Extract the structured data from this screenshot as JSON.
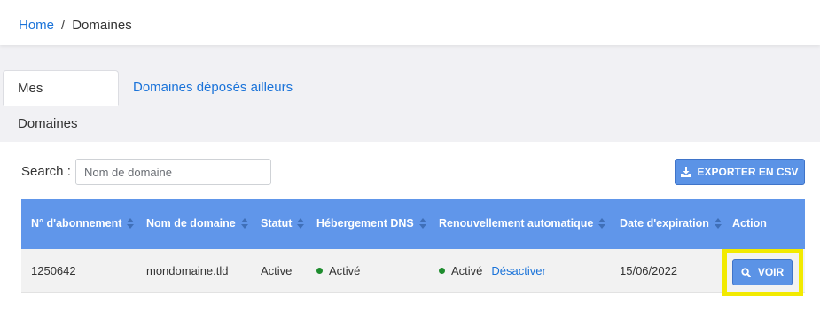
{
  "breadcrumb": {
    "home": "Home",
    "separator": "/",
    "current": "Domaines"
  },
  "tabs": [
    {
      "label": "Mes Domaines",
      "active": true
    },
    {
      "label": "Domaines déposés ailleurs",
      "active": false
    }
  ],
  "search": {
    "label": "Search :",
    "placeholder": "Nom de domaine",
    "value": ""
  },
  "export": {
    "label": "EXPORTER EN CSV",
    "icon": "download-icon"
  },
  "table": {
    "columns": [
      "N° d'abonnement",
      "Nom de domaine",
      "Statut",
      "Hébergement DNS",
      "Renouvellement automatique",
      "Date d'expiration",
      "Action"
    ],
    "rows": [
      {
        "subscription": "1250642",
        "domain": "mondomaine.tld",
        "status": "Active",
        "dns": "Activé",
        "renewal": "Activé",
        "renewal_action": "Désactiver",
        "expiration": "15/06/2022",
        "action_label": "VOIR"
      }
    ]
  },
  "colors": {
    "accent": "#1a73d9",
    "header_bg": "#6096ea",
    "button_bg": "#5b93e6",
    "status_dot": "#1e8c2e",
    "highlight": "#f2ea00"
  }
}
